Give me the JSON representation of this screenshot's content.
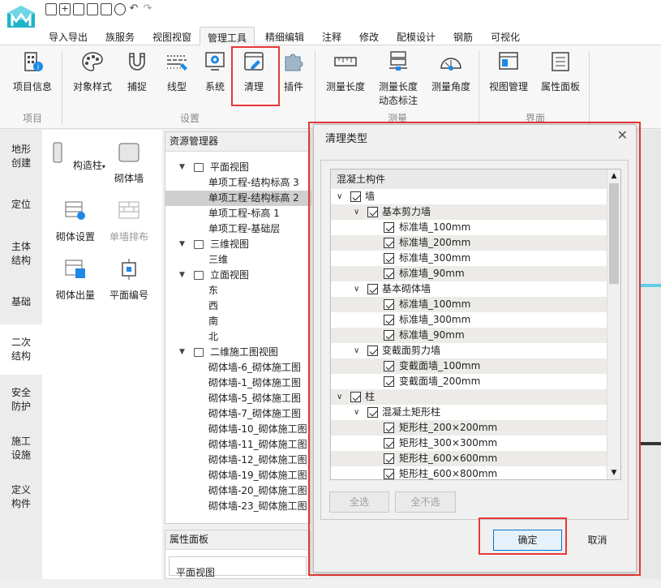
{
  "quick_access": {
    "icons": [
      "new-file-icon",
      "add-icon",
      "save-icon",
      "save-as-icon",
      "blank-page-icon",
      "close-icon",
      "undo-icon",
      "redo-icon"
    ]
  },
  "menu": {
    "items": [
      "导入导出",
      "族服务",
      "视图视窗",
      "管理工具",
      "精细编辑",
      "注释",
      "修改",
      "配模设计",
      "钢筋",
      "可视化"
    ],
    "active": "管理工具"
  },
  "ribbon": {
    "buttons": {
      "project_info": "项目信息",
      "object_style": "对象样式",
      "snap": "捕捉",
      "linetype": "线型",
      "system": "系统",
      "cleanup": "清理",
      "plugin": "插件",
      "measure_length": "测量长度",
      "measure_length_dyn_1": "测量长度",
      "measure_length_dyn_2": "动态标注",
      "measure_angle": "测量角度",
      "view_manage": "视图管理",
      "prop_panel": "属性面板"
    },
    "groups": {
      "project": "项目",
      "settings": "设置",
      "measure": "测量",
      "interface": "界面"
    }
  },
  "rail": {
    "items": [
      [
        "地形",
        "创建"
      ],
      [
        "定位"
      ],
      [
        "主体",
        "结构"
      ],
      [
        "基础"
      ],
      [
        "二次",
        "结构"
      ],
      [
        "安全",
        "防护"
      ],
      [
        "施工",
        "设施"
      ],
      [
        "定义",
        "构件"
      ]
    ],
    "active_index": 4
  },
  "palette": {
    "items": {
      "column": "构造柱",
      "masonry_wall": "砌体墙",
      "masonry_setting": "砌体设置",
      "single_wall_layout": "单墙排布",
      "masonry_output": "砌体出量",
      "plan_numbering": "平面编号"
    }
  },
  "resource_manager": {
    "title": "资源管理器",
    "floor_plan": "平面视图",
    "floor_plan_items": [
      "单项工程-结构标高 3",
      "单项工程-结构标高 2",
      "单项工程-标高 1",
      "单项工程-基础层"
    ],
    "selected": "单项工程-结构标高 2",
    "view_3d": "三维视图",
    "view_3d_items": [
      "三维"
    ],
    "elevation": "立面视图",
    "elevation_items": [
      "东",
      "西",
      "南",
      "北"
    ],
    "drawing_2d": "二维施工图视图",
    "drawing_2d_items": [
      "砌体墙-6_砌体施工图",
      "砌体墙-1_砌体施工图",
      "砌体墙-5_砌体施工图",
      "砌体墙-7_砌体施工图",
      "砌体墙-10_砌体施工图",
      "砌体墙-11_砌体施工图",
      "砌体墙-12_砌体施工图",
      "砌体墙-19_砌体施工图",
      "砌体墙-20_砌体施工图",
      "砌体墙-23_砌体施工图"
    ]
  },
  "property_panel": {
    "title": "属性面板",
    "selected_view": "平面视图"
  },
  "dialog": {
    "title": "清理类型",
    "list_header": "混凝土构件",
    "wall": "墙",
    "basic_shear_wall": "基本剪力墙",
    "shear_items": [
      "标准墙_100mm",
      "标准墙_200mm",
      "标准墙_300mm",
      "标准墙_90mm"
    ],
    "basic_masonry_wall": "基本砌体墙",
    "masonry_items": [
      "标准墙_100mm",
      "标准墙_300mm",
      "标准墙_90mm"
    ],
    "variable_shear_wall": "变截面剪力墙",
    "variable_items": [
      "变截面墙_100mm",
      "变截面墙_200mm"
    ],
    "column": "柱",
    "rect_column": "混凝土矩形柱",
    "rect_items": [
      "矩形柱_200×200mm",
      "矩形柱_300×300mm",
      "矩形柱_600×600mm",
      "矩形柱_600×800mm"
    ],
    "select_all": "全选",
    "deselect_all": "全不选",
    "ok": "确定",
    "cancel": "取消"
  }
}
